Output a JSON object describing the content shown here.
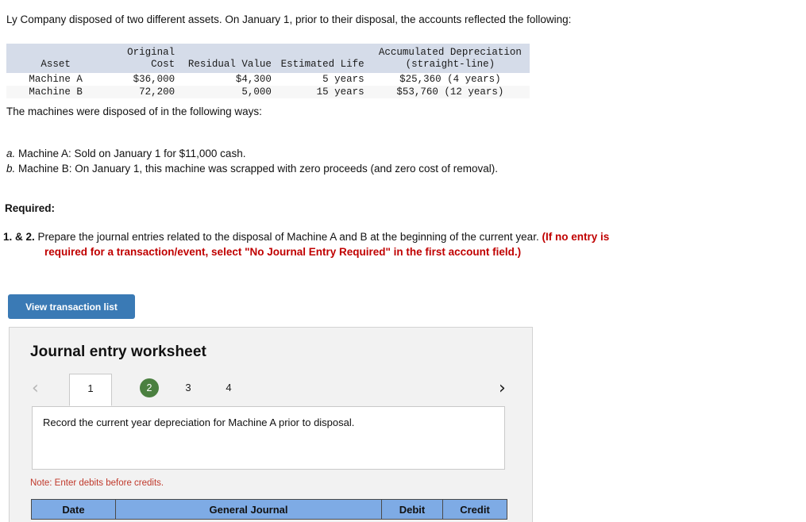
{
  "intro": {
    "text": "Ly Company disposed of two different assets. On January 1, prior to their disposal, the accounts reflected the following:"
  },
  "fact_table": {
    "headers": {
      "asset": "Asset",
      "original_cost_line1": "Original",
      "original_cost_line2": "Cost",
      "residual_value": "Residual Value",
      "estimated_life": "Estimated Life",
      "accum_dep_line1": "Accumulated Depreciation",
      "accum_dep_line2": "(straight-line)"
    },
    "rows": [
      {
        "asset": "Machine A",
        "cost": "$36,000",
        "residual": "$4,300",
        "life": "5 years",
        "accum": "$25,360 (4 years)"
      },
      {
        "asset": "Machine B",
        "cost": "72,200",
        "residual": "5,000",
        "life": "15 years",
        "accum": "$53,760 (12 years)"
      }
    ],
    "header_bg": "#d5dce9"
  },
  "machines_line": {
    "text": "The machines were disposed of in the following ways:"
  },
  "disposal": {
    "items": [
      {
        "mark": "a.",
        "text": " Machine A: Sold on January 1 for $11,000 cash."
      },
      {
        "mark": "b.",
        "text": " Machine B: On January 1, this machine was scrapped with zero proceeds (and zero cost of removal)."
      }
    ]
  },
  "required": {
    "heading": "Required:",
    "number": "1. & 2.",
    "body": " Prepare the journal entries related to the disposal of Machine A and B at the beginning of the current year. ",
    "red_line1": "(If no entry is",
    "red_line2": "required for a transaction/event, select \"No Journal Entry Required\" in the first account field.)"
  },
  "view_transaction_button": {
    "label": "View transaction list",
    "color": "#3a7ab5"
  },
  "worksheet": {
    "title": "Journal entry worksheet",
    "nav": {
      "prev_icon": "‹",
      "next_icon": "›"
    },
    "tabs": [
      {
        "label": "1",
        "state": "active"
      },
      {
        "label": "2",
        "state": "badge"
      },
      {
        "label": "3",
        "state": "normal"
      },
      {
        "label": "4",
        "state": "normal"
      }
    ],
    "badge_color": "#4b8040",
    "description": "Record the current year depreciation for Machine A prior to disposal.",
    "note": "Note: Enter debits before credits.",
    "journal_headers": {
      "date": "Date",
      "general_journal": "General Journal",
      "debit": "Debit",
      "credit": "Credit"
    },
    "journal_header_bg": "#7eabe5"
  }
}
